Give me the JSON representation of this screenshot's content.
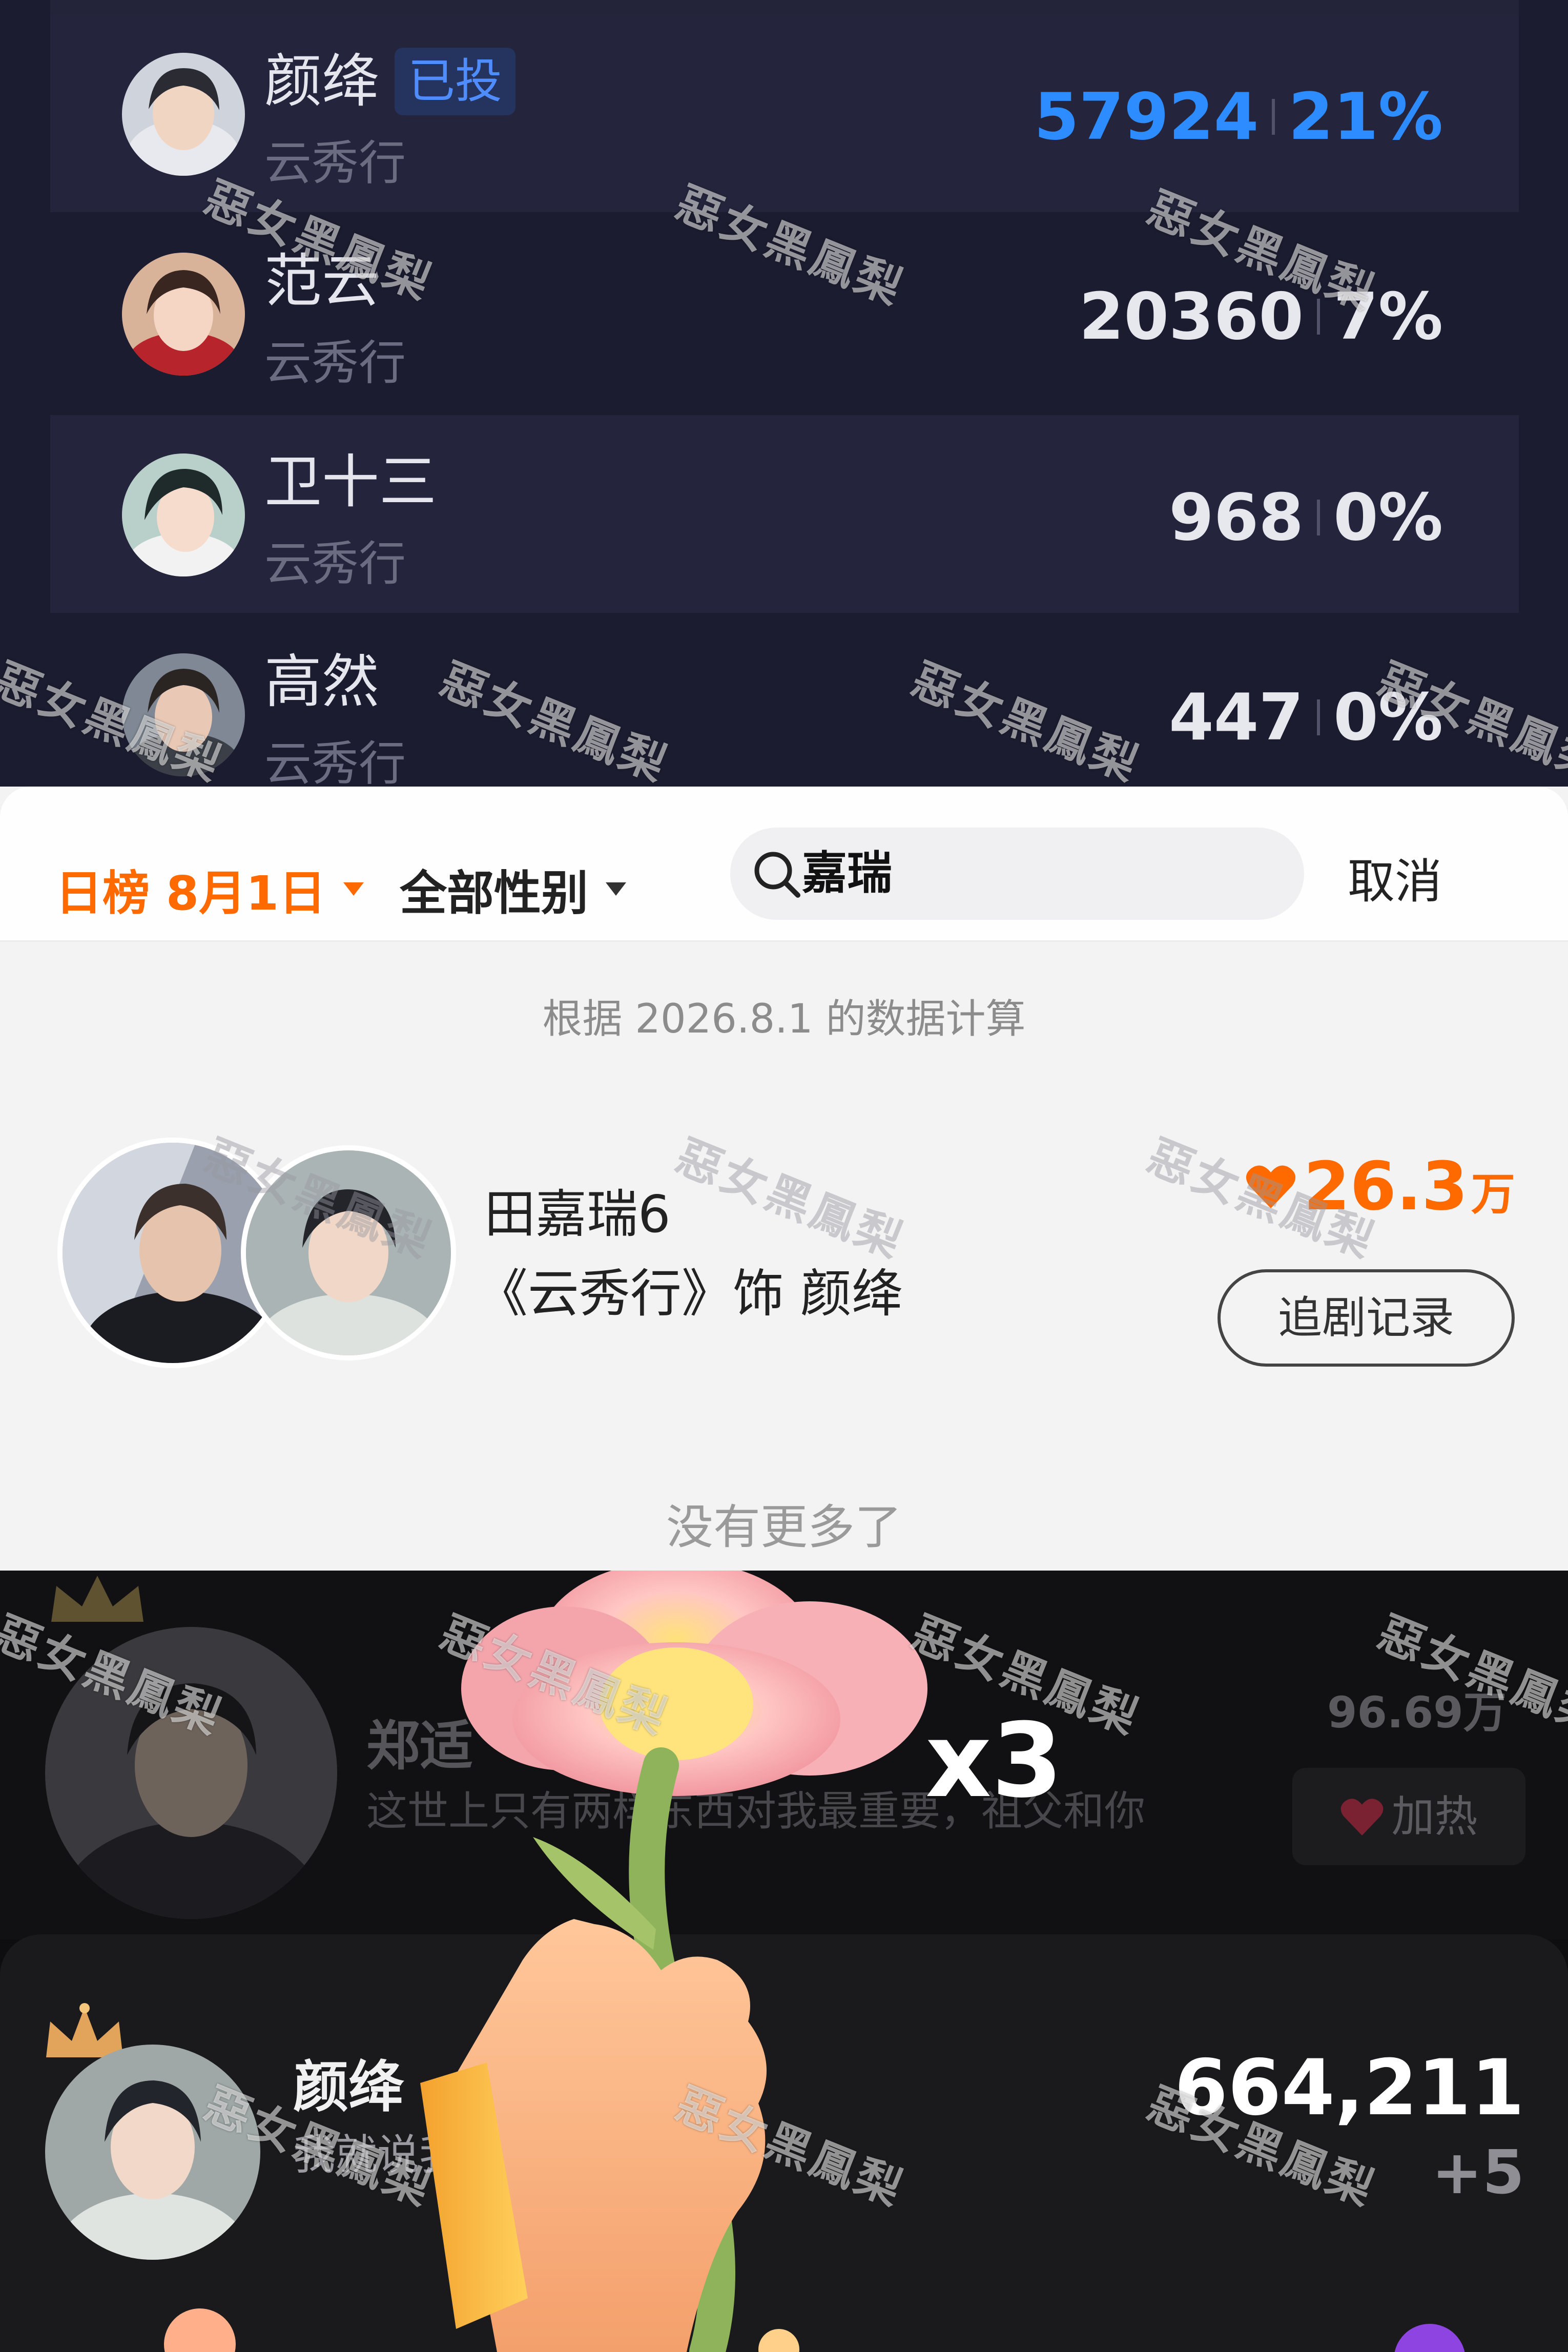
{
  "vote_list": {
    "items": [
      {
        "name": "颜绛",
        "drama": "云秀行",
        "tag": "已投",
        "votes": "57924",
        "percent": "21%"
      },
      {
        "name": "范云",
        "drama": "云秀行",
        "votes": "20360",
        "percent": "7%"
      },
      {
        "name": "卫十三",
        "drama": "云秀行",
        "votes": "968",
        "percent": "0%"
      },
      {
        "name": "高然",
        "drama": "云秀行",
        "votes": "447",
        "percent": "0%"
      }
    ],
    "colors": {
      "accent": "#2d8cff",
      "row_bg_a": "#23243a",
      "row_bg_b": "#1e1f34"
    }
  },
  "search": {
    "filter_date": "日榜 8月1日",
    "filter_gender": "全部性别",
    "query": "嘉瑞",
    "cancel": "取消",
    "note": "根据 2026.8.1 的数据计算",
    "result": {
      "name": "田嘉瑞6",
      "role": "《云秀行》饰 颜绛",
      "heat_value": "26.3",
      "heat_unit": "万",
      "button": "追剧记录"
    },
    "end_text": "没有更多了",
    "colors": {
      "accent": "#ff6a00"
    }
  },
  "gift": {
    "top_entry": {
      "name": "郑适",
      "quote": "这世上只有两样东西对我最重要，祖父和你",
      "score": "96.69万",
      "boost_button": "加热"
    },
    "combo": "x3",
    "mine": {
      "name": "颜绛",
      "quote": "我就说我",
      "score": "664,211",
      "delta": "+5"
    }
  },
  "watermark": "惡女黑鳳梨"
}
